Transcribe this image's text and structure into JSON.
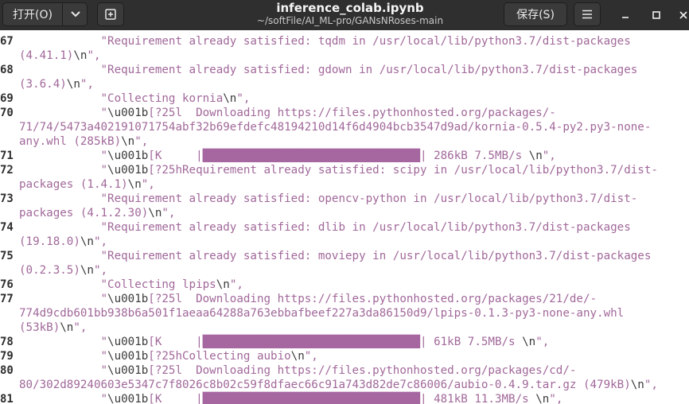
{
  "titlebar": {
    "open_label": "打开(O)",
    "title": "inference_colab.ipynb",
    "path": "~/softFile/AI_ML-pro/GANsNRoses-main",
    "save_label": "保存(S)"
  },
  "lines": [
    {
      "num": "67",
      "segments": [
        {
          "t": "txt",
          "v": "            \"Requirement already satisfied: tqdm in /usr/local/lib/python3.7/dist-packages"
        }
      ]
    },
    {
      "num": "",
      "segments": [
        {
          "t": "txt",
          "v": "(4.41.1)"
        },
        {
          "t": "esc",
          "v": "\\n"
        },
        {
          "t": "txt",
          "v": "\","
        }
      ]
    },
    {
      "num": "68",
      "segments": [
        {
          "t": "txt",
          "v": "            \"Requirement already satisfied: gdown in /usr/local/lib/python3.7/dist-packages"
        }
      ]
    },
    {
      "num": "",
      "segments": [
        {
          "t": "txt",
          "v": "(3.6.4)"
        },
        {
          "t": "esc",
          "v": "\\n"
        },
        {
          "t": "txt",
          "v": "\","
        }
      ]
    },
    {
      "num": "69",
      "segments": [
        {
          "t": "txt",
          "v": "            \"Collecting kornia"
        },
        {
          "t": "esc",
          "v": "\\n"
        },
        {
          "t": "txt",
          "v": "\","
        }
      ]
    },
    {
      "num": "70",
      "segments": [
        {
          "t": "txt",
          "v": "            \""
        },
        {
          "t": "esc",
          "v": "\\u001b"
        },
        {
          "t": "txt",
          "v": "[?25l  Downloading https://files.pythonhosted.org/packages/-"
        }
      ]
    },
    {
      "num": "",
      "segments": [
        {
          "t": "txt",
          "v": "71/74/5473a402191071754abf32b69efdefc48194210d14f6d4904bcb3547d9ad/kornia-0.5.4-py2.py3-none-"
        }
      ]
    },
    {
      "num": "",
      "segments": [
        {
          "t": "txt",
          "v": "any.whl (285kB)"
        },
        {
          "t": "esc",
          "v": "\\n"
        },
        {
          "t": "txt",
          "v": "\","
        }
      ]
    },
    {
      "num": "71",
      "segments": [
        {
          "t": "txt",
          "v": "            \""
        },
        {
          "t": "esc",
          "v": "\\u001b"
        },
        {
          "t": "txt",
          "v": "[K     |"
        },
        {
          "t": "bar",
          "v": "████████████████████████████████"
        },
        {
          "t": "txt",
          "v": "| 286kB 7.5MB/s "
        },
        {
          "t": "esc",
          "v": "\\n"
        },
        {
          "t": "txt",
          "v": "\","
        }
      ]
    },
    {
      "num": "72",
      "segments": [
        {
          "t": "txt",
          "v": "            \""
        },
        {
          "t": "esc",
          "v": "\\u001b"
        },
        {
          "t": "txt",
          "v": "[?25hRequirement already satisfied: scipy in /usr/local/lib/python3.7/dist-"
        }
      ]
    },
    {
      "num": "",
      "segments": [
        {
          "t": "txt",
          "v": "packages (1.4.1)"
        },
        {
          "t": "esc",
          "v": "\\n"
        },
        {
          "t": "txt",
          "v": "\","
        }
      ]
    },
    {
      "num": "73",
      "segments": [
        {
          "t": "txt",
          "v": "            \"Requirement already satisfied: opencv-python in /usr/local/lib/python3.7/dist-"
        }
      ]
    },
    {
      "num": "",
      "segments": [
        {
          "t": "txt",
          "v": "packages (4.1.2.30)"
        },
        {
          "t": "esc",
          "v": "\\n"
        },
        {
          "t": "txt",
          "v": "\","
        }
      ]
    },
    {
      "num": "74",
      "segments": [
        {
          "t": "txt",
          "v": "            \"Requirement already satisfied: dlib in /usr/local/lib/python3.7/dist-packages"
        }
      ]
    },
    {
      "num": "",
      "segments": [
        {
          "t": "txt",
          "v": "(19.18.0)"
        },
        {
          "t": "esc",
          "v": "\\n"
        },
        {
          "t": "txt",
          "v": "\","
        }
      ]
    },
    {
      "num": "75",
      "segments": [
        {
          "t": "txt",
          "v": "            \"Requirement already satisfied: moviepy in /usr/local/lib/python3.7/dist-packages"
        }
      ]
    },
    {
      "num": "",
      "segments": [
        {
          "t": "txt",
          "v": "(0.2.3.5)"
        },
        {
          "t": "esc",
          "v": "\\n"
        },
        {
          "t": "txt",
          "v": "\","
        }
      ]
    },
    {
      "num": "76",
      "segments": [
        {
          "t": "txt",
          "v": "            \"Collecting lpips"
        },
        {
          "t": "esc",
          "v": "\\n"
        },
        {
          "t": "txt",
          "v": "\","
        }
      ]
    },
    {
      "num": "77",
      "segments": [
        {
          "t": "txt",
          "v": "            \""
        },
        {
          "t": "esc",
          "v": "\\u001b"
        },
        {
          "t": "txt",
          "v": "[?25l  Downloading https://files.pythonhosted.org/packages/21/de/-"
        }
      ]
    },
    {
      "num": "",
      "segments": [
        {
          "t": "txt",
          "v": "774d9cdb601bb938b6a501f1aeaa64288a763ebbafbeef227a3da86150d9/lpips-0.1.3-py3-none-any.whl"
        }
      ]
    },
    {
      "num": "",
      "segments": [
        {
          "t": "txt",
          "v": "(53kB)"
        },
        {
          "t": "esc",
          "v": "\\n"
        },
        {
          "t": "txt",
          "v": "\","
        }
      ]
    },
    {
      "num": "78",
      "segments": [
        {
          "t": "txt",
          "v": "            \""
        },
        {
          "t": "esc",
          "v": "\\u001b"
        },
        {
          "t": "txt",
          "v": "[K     |"
        },
        {
          "t": "bar",
          "v": "████████████████████████████████"
        },
        {
          "t": "txt",
          "v": "| 61kB 7.5MB/s "
        },
        {
          "t": "esc",
          "v": "\\n"
        },
        {
          "t": "txt",
          "v": "\","
        }
      ]
    },
    {
      "num": "79",
      "segments": [
        {
          "t": "txt",
          "v": "            \""
        },
        {
          "t": "esc",
          "v": "\\u001b"
        },
        {
          "t": "txt",
          "v": "[?25hCollecting aubio"
        },
        {
          "t": "esc",
          "v": "\\n"
        },
        {
          "t": "txt",
          "v": "\","
        }
      ]
    },
    {
      "num": "80",
      "segments": [
        {
          "t": "txt",
          "v": "            \""
        },
        {
          "t": "esc",
          "v": "\\u001b"
        },
        {
          "t": "txt",
          "v": "[?25l  Downloading https://files.pythonhosted.org/packages/cd/-"
        }
      ]
    },
    {
      "num": "",
      "segments": [
        {
          "t": "txt",
          "v": "80/302d89240603e5347c7f8026c8b02c59f8dfaec66c91a743d82de7c86006/aubio-0.4.9.tar.gz (479kB)"
        },
        {
          "t": "esc",
          "v": "\\n"
        },
        {
          "t": "txt",
          "v": "\","
        }
      ]
    },
    {
      "num": "81",
      "segments": [
        {
          "t": "txt",
          "v": "            \""
        },
        {
          "t": "esc",
          "v": "\\u001b"
        },
        {
          "t": "txt",
          "v": "[K     |"
        },
        {
          "t": "bar",
          "v": "████████████████████████████████"
        },
        {
          "t": "txt",
          "v": "| 481kB 11.3MB/s "
        },
        {
          "t": "esc",
          "v": "\\n"
        },
        {
          "t": "txt",
          "v": "\","
        }
      ]
    }
  ]
}
